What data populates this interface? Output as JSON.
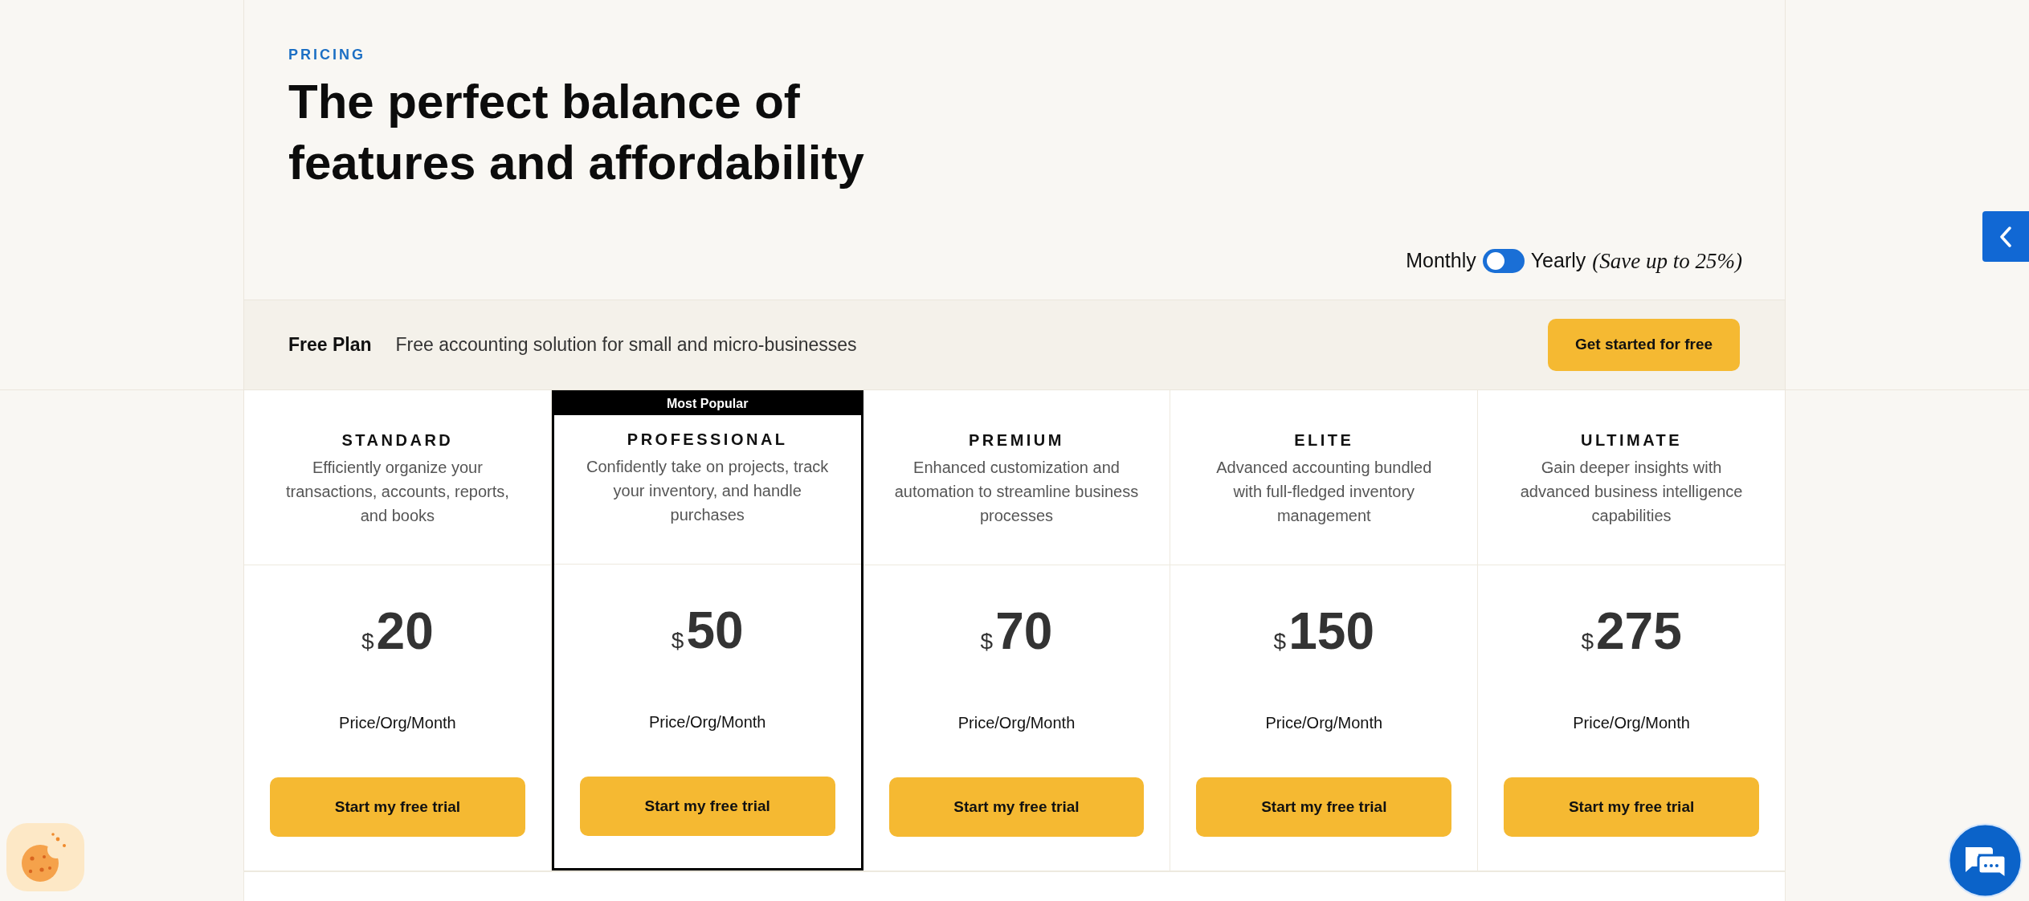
{
  "section": {
    "eyebrow": "PRICING",
    "title": "The perfect balance of features and affordability"
  },
  "billing": {
    "monthly_label": "Monthly",
    "yearly_label": "Yearly",
    "yearly": false,
    "savings_note": "(Save up to 25%)"
  },
  "free_plan": {
    "name": "Free Plan",
    "description": "Free accounting solution for small and micro-businesses",
    "button": "Get started for free"
  },
  "plans": [
    {
      "name": "STANDARD",
      "description": "Efficiently organize your transactions, accounts, reports, and books",
      "currency": "$",
      "price": "20",
      "period": "Price/Org/Month",
      "button": "Start my free trial",
      "highlighted": false
    },
    {
      "name": "PROFESSIONAL",
      "badge": "Most Popular",
      "description": "Confidently take on projects, track your inventory, and handle purchases",
      "currency": "$",
      "price": "50",
      "period": "Price/Org/Month",
      "button": "Start my free trial",
      "highlighted": true
    },
    {
      "name": "PREMIUM",
      "description": "Enhanced customization and automation to streamline business processes",
      "currency": "$",
      "price": "70",
      "period": "Price/Org/Month",
      "button": "Start my free trial",
      "highlighted": false
    },
    {
      "name": "ELITE",
      "description": "Advanced accounting bundled with full-fledged inventory management",
      "currency": "$",
      "price": "150",
      "period": "Price/Org/Month",
      "button": "Start my free trial",
      "highlighted": false
    },
    {
      "name": "ULTIMATE",
      "description": "Gain deeper insights with advanced business intelligence capabilities",
      "currency": "$",
      "price": "275",
      "period": "Price/Org/Month",
      "button": "Start my free trial",
      "highlighted": false
    }
  ]
}
